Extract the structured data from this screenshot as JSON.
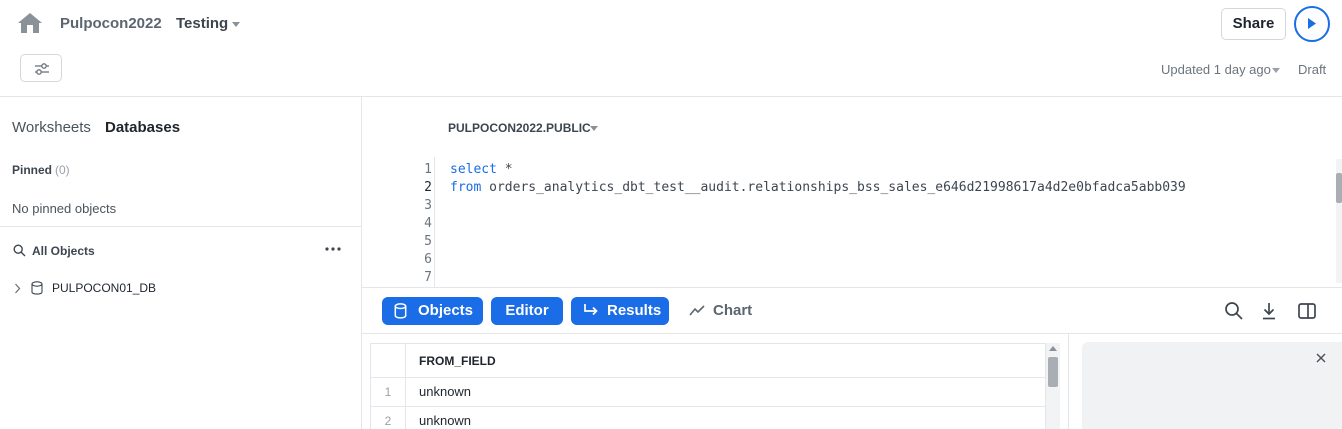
{
  "header": {
    "database": "Pulpocon2022",
    "worksheet": "Testing",
    "share_label": "Share",
    "updated": "Updated 1 day ago",
    "status": "Draft"
  },
  "left_panel": {
    "tabs": [
      "Worksheets",
      "Databases"
    ],
    "active_tab": "Databases",
    "pinned_label": "Pinned",
    "pinned_count": "(0)",
    "no_pinned": "No pinned objects",
    "all_objects": "All Objects",
    "tree": [
      {
        "label": "PULPOCON01_DB",
        "icon": "database-icon"
      }
    ]
  },
  "editor": {
    "context": "PULPOCON2022.PUBLIC",
    "line_numbers": [
      "1",
      "2",
      "3",
      "4",
      "5",
      "6",
      "7"
    ],
    "active_line": "2",
    "lines": [
      {
        "kw": "select",
        "rest": " *"
      },
      {
        "kw": "from",
        "rest": " orders_analytics_dbt_test__audit.relationships_bss_sales_e646d21998617a4d2e0bfadca5abb039"
      }
    ]
  },
  "toolbar": {
    "objects_label": "Objects",
    "editor_label": "Editor",
    "results_label": "Results",
    "chart_label": "Chart",
    "icons": [
      "search-icon",
      "download-icon",
      "split-panel-icon"
    ]
  },
  "results": {
    "columns": [
      "FROM_FIELD"
    ],
    "rows": [
      {
        "index": "1",
        "FROM_FIELD": "unknown"
      },
      {
        "index": "2",
        "FROM_FIELD": "unknown"
      }
    ]
  },
  "colors": {
    "accent": "#1a6ce7",
    "text": "#1e252d",
    "muted": "#6b747d",
    "border": "#e3e6ea",
    "inspector_bg": "#f1f2f4"
  }
}
